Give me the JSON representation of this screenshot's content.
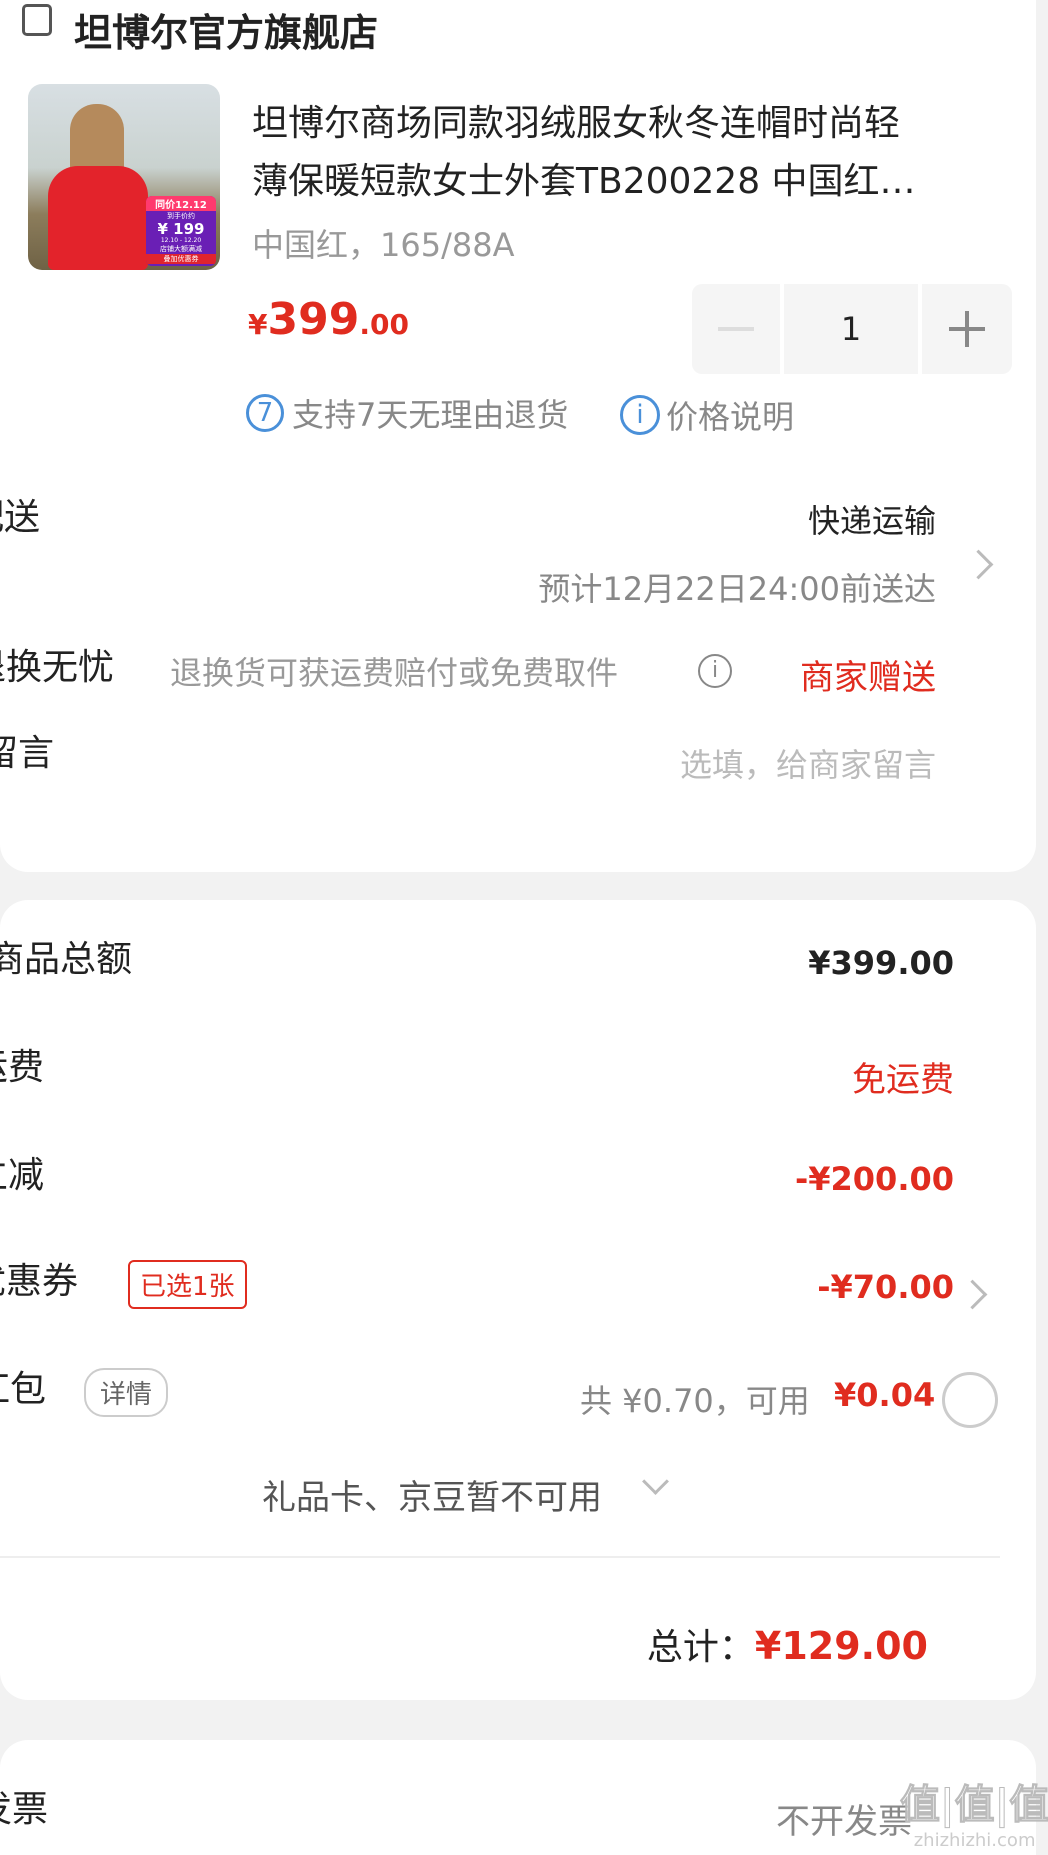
{
  "store": {
    "name": "坦博尔官方旗舰店"
  },
  "product": {
    "title_line1": "坦博尔商场同款羽绒服女秋冬连帽时尚轻",
    "title_line2": "薄保暖短款女士外套TB200228 中国红…",
    "spec": "中国红，165/88A",
    "price_symbol": "¥",
    "price_int": "399",
    "price_dec": ".00",
    "quantity": "1",
    "thumb": {
      "badge_top": "同价12.12",
      "badge_sub": "到手价约",
      "badge_price": "¥ 199",
      "badge_date": "12.10 - 12.20",
      "badge_bottom1": "店铺大额满减",
      "badge_bottom2": "叠加优惠券"
    },
    "guarantee_icon": "7",
    "guarantee": "支持7天无理由退货",
    "price_info_icon": "i",
    "price_info": "价格说明"
  },
  "delivery": {
    "label": "配送",
    "method": "快递运输",
    "eta": "预计12月22日24:00前送达"
  },
  "worry_free": {
    "label": "退换无忧",
    "desc": "退换货可获运费赔付或免费取件",
    "value": "商家赠送"
  },
  "message": {
    "label": "留言",
    "placeholder": "选填，给商家留言"
  },
  "summary": {
    "goods_total_label": "商品总额",
    "goods_total": "¥399.00",
    "shipping_label": "运费",
    "shipping": "免运费",
    "discount_label": "立减",
    "discount": "-¥200.00",
    "coupon_label": "优惠券",
    "coupon_tag": "已选1张",
    "coupon": "-¥70.00",
    "redpacket_label": "红包",
    "redpacket_tag": "详情",
    "redpacket_total": "共 ¥0.70，可用",
    "redpacket_usable": "¥0.04",
    "giftcard": "礼品卡、京豆暂不可用",
    "total_label": "总计：",
    "total": "¥129.00"
  },
  "invoice": {
    "label": "发票",
    "value": "不开发票"
  },
  "watermark": {
    "text": "值|值|值",
    "sub": "zhizhizhi.com"
  },
  "colors": {
    "accent": "#e02c1f",
    "blue": "#4a90d9",
    "bg": "#f2f2f2"
  }
}
